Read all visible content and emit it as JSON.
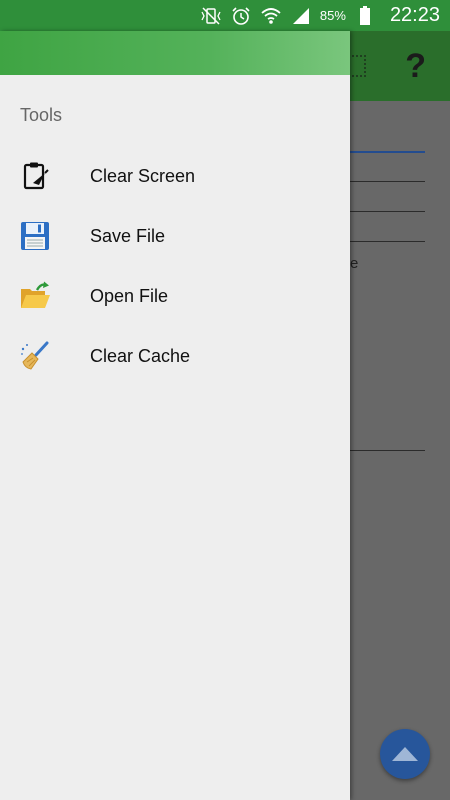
{
  "status_bar": {
    "battery_percent": "85%",
    "time": "22:23",
    "icons": [
      "mute-vibrate-icon",
      "alarm-icon",
      "wifi-icon",
      "signal-icon",
      "battery-icon"
    ]
  },
  "background": {
    "help_glyph": "?",
    "partial_text": "e"
  },
  "drawer": {
    "section_title": "Tools",
    "items": [
      {
        "label": "Clear Screen",
        "icon": "clipboard-icon"
      },
      {
        "label": "Save File",
        "icon": "floppy-disk-icon"
      },
      {
        "label": "Open File",
        "icon": "open-folder-icon"
      },
      {
        "label": "Clear Cache",
        "icon": "broom-icon"
      }
    ]
  },
  "colors": {
    "status_bar": "#2f8f3a",
    "drawer_header": "#4caf50",
    "drawer_bg": "#eeeeee",
    "fab": "#27569b"
  }
}
